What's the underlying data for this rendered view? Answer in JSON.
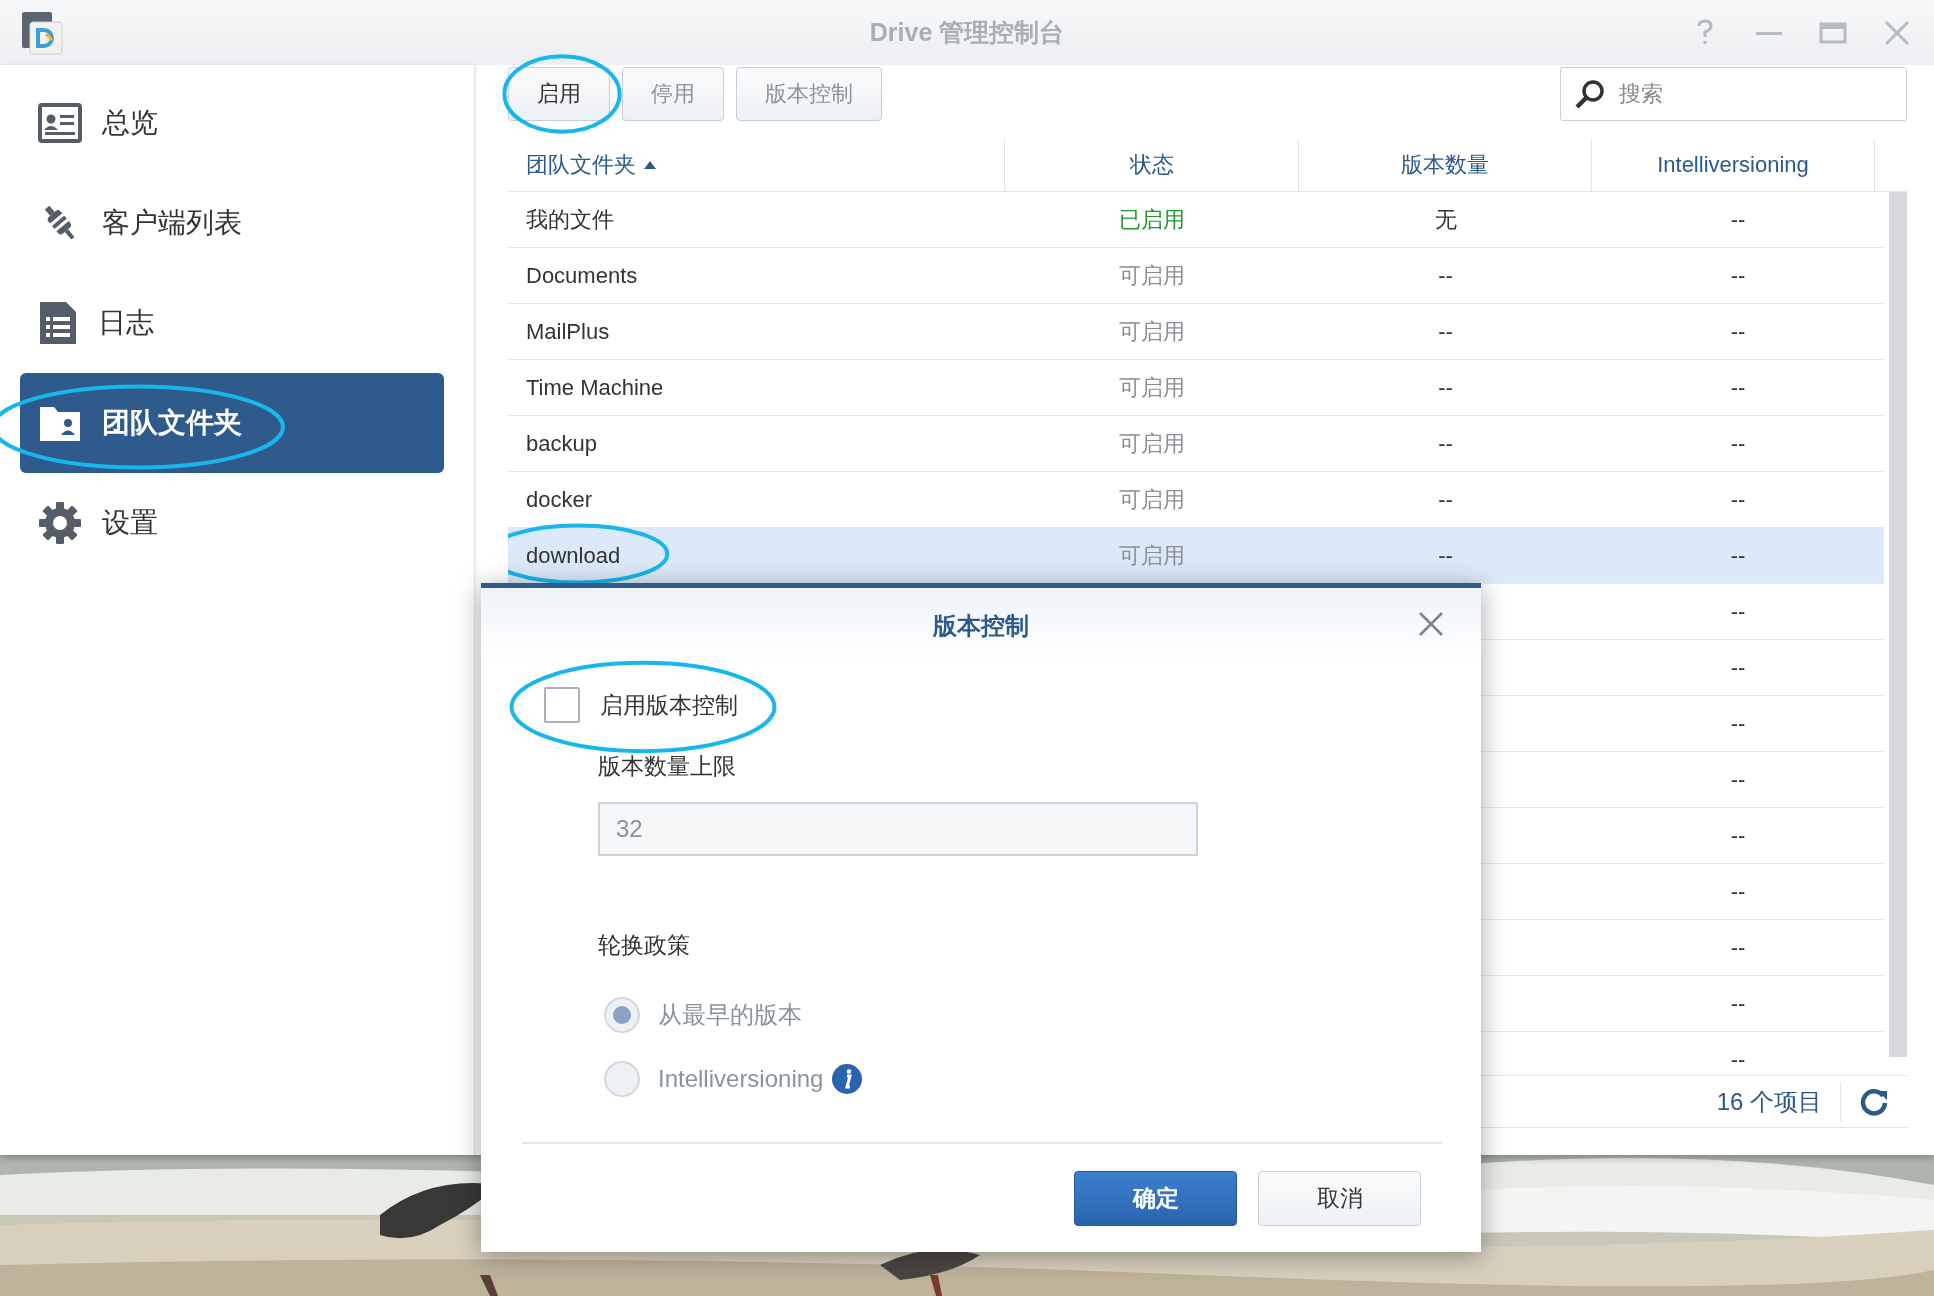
{
  "window": {
    "title": "Drive 管理控制台"
  },
  "sidebar": {
    "items": [
      {
        "label": "总览",
        "selected": false,
        "circled": false
      },
      {
        "label": "客户端列表",
        "selected": false,
        "circled": false
      },
      {
        "label": "日志",
        "selected": false,
        "circled": false
      },
      {
        "label": "团队文件夹",
        "selected": true,
        "circled": true
      },
      {
        "label": "设置",
        "selected": false,
        "circled": false
      }
    ]
  },
  "toolbar": {
    "buttons": [
      {
        "label": "启用",
        "circled": true
      },
      {
        "label": "停用",
        "circled": false
      },
      {
        "label": "版本控制",
        "circled": false
      }
    ],
    "search": {
      "placeholder": "搜索"
    }
  },
  "table": {
    "columns": [
      {
        "label": "团队文件夹",
        "sorted": true
      },
      {
        "label": "状态",
        "sorted": false
      },
      {
        "label": "版本数量",
        "sorted": false
      },
      {
        "label": "Intelliversioning",
        "sorted": false
      }
    ],
    "rows": [
      {
        "name": "我的文件",
        "status": "已启用",
        "status_enabled": true,
        "versions": "无",
        "intelliversioning": "--",
        "selected": false,
        "circled": false
      },
      {
        "name": "Documents",
        "status": "可启用",
        "status_enabled": false,
        "versions": "--",
        "intelliversioning": "--",
        "selected": false,
        "circled": false
      },
      {
        "name": "MailPlus",
        "status": "可启用",
        "status_enabled": false,
        "versions": "--",
        "intelliversioning": "--",
        "selected": false,
        "circled": false
      },
      {
        "name": "Time Machine",
        "status": "可启用",
        "status_enabled": false,
        "versions": "--",
        "intelliversioning": "--",
        "selected": false,
        "circled": false
      },
      {
        "name": "backup",
        "status": "可启用",
        "status_enabled": false,
        "versions": "--",
        "intelliversioning": "--",
        "selected": false,
        "circled": false
      },
      {
        "name": "docker",
        "status": "可启用",
        "status_enabled": false,
        "versions": "--",
        "intelliversioning": "--",
        "selected": false,
        "circled": false
      },
      {
        "name": "download",
        "status": "可启用",
        "status_enabled": false,
        "versions": "--",
        "intelliversioning": "--",
        "selected": true,
        "circled": true
      },
      {
        "intelliversioning": "--",
        "selected": false,
        "circled": false
      },
      {
        "intelliversioning": "--",
        "selected": false,
        "circled": false
      },
      {
        "intelliversioning": "--",
        "selected": false,
        "circled": false
      },
      {
        "intelliversioning": "--",
        "selected": false,
        "circled": false
      },
      {
        "intelliversioning": "--",
        "selected": false,
        "circled": false
      },
      {
        "intelliversioning": "--",
        "selected": false,
        "circled": false
      },
      {
        "intelliversioning": "--",
        "selected": false,
        "circled": false
      },
      {
        "intelliversioning": "--",
        "selected": false,
        "circled": false
      },
      {
        "intelliversioning": "--",
        "selected": false,
        "circled": false
      }
    ],
    "footer": {
      "count": "16 个项目"
    }
  },
  "dialog": {
    "title": "版本控制",
    "checkbox": {
      "label": "启用版本控制",
      "checked": false,
      "circled": true
    },
    "limit": {
      "label": "版本数量上限",
      "value": "32",
      "disabled": true
    },
    "rotation": {
      "label": "轮换政策",
      "options": [
        {
          "label": "从最早的版本",
          "selected": true,
          "disabled": true,
          "info": false
        },
        {
          "label": "Intelliversioning",
          "selected": false,
          "disabled": true,
          "info": true
        }
      ]
    },
    "buttons": [
      {
        "label": "确定",
        "kind": "primary"
      },
      {
        "label": "取消",
        "kind": "secondary"
      }
    ]
  }
}
